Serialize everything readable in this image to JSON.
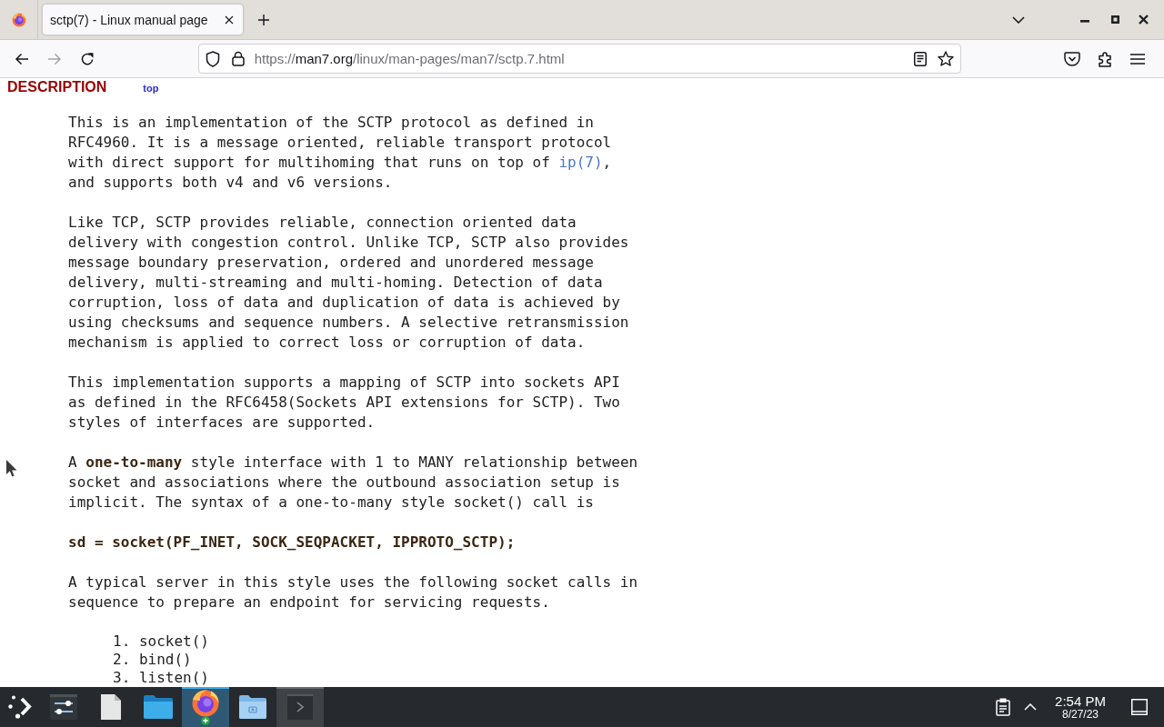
{
  "tabs": [
    {
      "title": "sctp(7) - Linux manual page",
      "selected": true
    }
  ],
  "navigation": {
    "back": {
      "disabled": false
    },
    "forward": {
      "disabled": true
    }
  },
  "address_bar": {
    "scheme": "https://",
    "host": "man7.org",
    "path": "/linux/man-pages/man7/sctp.7.html"
  },
  "page": {
    "heading": "DESCRIPTION",
    "top_link": "top",
    "blocks": [
      {
        "kind": "paragraph",
        "parts": [
          {
            "kind": "text",
            "text": "This is an implementation of the SCTP protocol as defined in\nRFC4960. It is a message oriented, reliable transport protocol\nwith direct support for multihoming that runs on top of "
          },
          {
            "kind": "link",
            "text": "ip(7)"
          },
          {
            "kind": "text",
            "text": ",\nand supports both v4 and v6 versions."
          }
        ]
      },
      {
        "kind": "paragraph",
        "parts": [
          {
            "kind": "text",
            "text": "Like TCP, SCTP provides reliable, connection oriented data\ndelivery with congestion control. Unlike TCP, SCTP also provides\nmessage boundary preservation, ordered and unordered message\ndelivery, multi-streaming and multi-homing. Detection of data\ncorruption, loss of data and duplication of data is achieved by\nusing checksums and sequence numbers. A selective retransmission\nmechanism is applied to correct loss or corruption of data."
          }
        ]
      },
      {
        "kind": "paragraph",
        "parts": [
          {
            "kind": "text",
            "text": "This implementation supports a mapping of SCTP into sockets API\nas defined in the RFC6458(Sockets API extensions for SCTP). Two\nstyles of interfaces are supported."
          }
        ]
      },
      {
        "kind": "paragraph",
        "parts": [
          {
            "kind": "text",
            "text": "A **one-to-many** style interface with 1 to MANY relationship between\nsocket and associations where the outbound association setup is\nimplicit. The syntax of a one-to-many style socket() call is"
          }
        ]
      },
      {
        "kind": "code",
        "text": "sd = socket(PF_INET, SOCK_SEQPACKET, IPPROTO_SCTP);"
      },
      {
        "kind": "paragraph",
        "parts": [
          {
            "kind": "text",
            "text": "A typical server in this style uses the following socket calls in\nsequence to prepare an endpoint for servicing requests."
          }
        ]
      },
      {
        "kind": "list",
        "items": [
          "1. socket()",
          "2. bind()",
          "3. listen()"
        ]
      }
    ]
  },
  "taskbar": {
    "apps": [
      {
        "kind": "settings",
        "running": false,
        "selected": false
      },
      {
        "kind": "document",
        "running": false,
        "selected": false
      },
      {
        "kind": "folder",
        "running": false,
        "selected": false
      },
      {
        "kind": "browser",
        "running": true,
        "selected": true
      },
      {
        "kind": "camera",
        "running": false,
        "selected": false
      },
      {
        "kind": "terminal",
        "running": true,
        "selected": false
      }
    ],
    "clock": {
      "time": "2:54 PM",
      "date": "8/27/23"
    }
  }
}
